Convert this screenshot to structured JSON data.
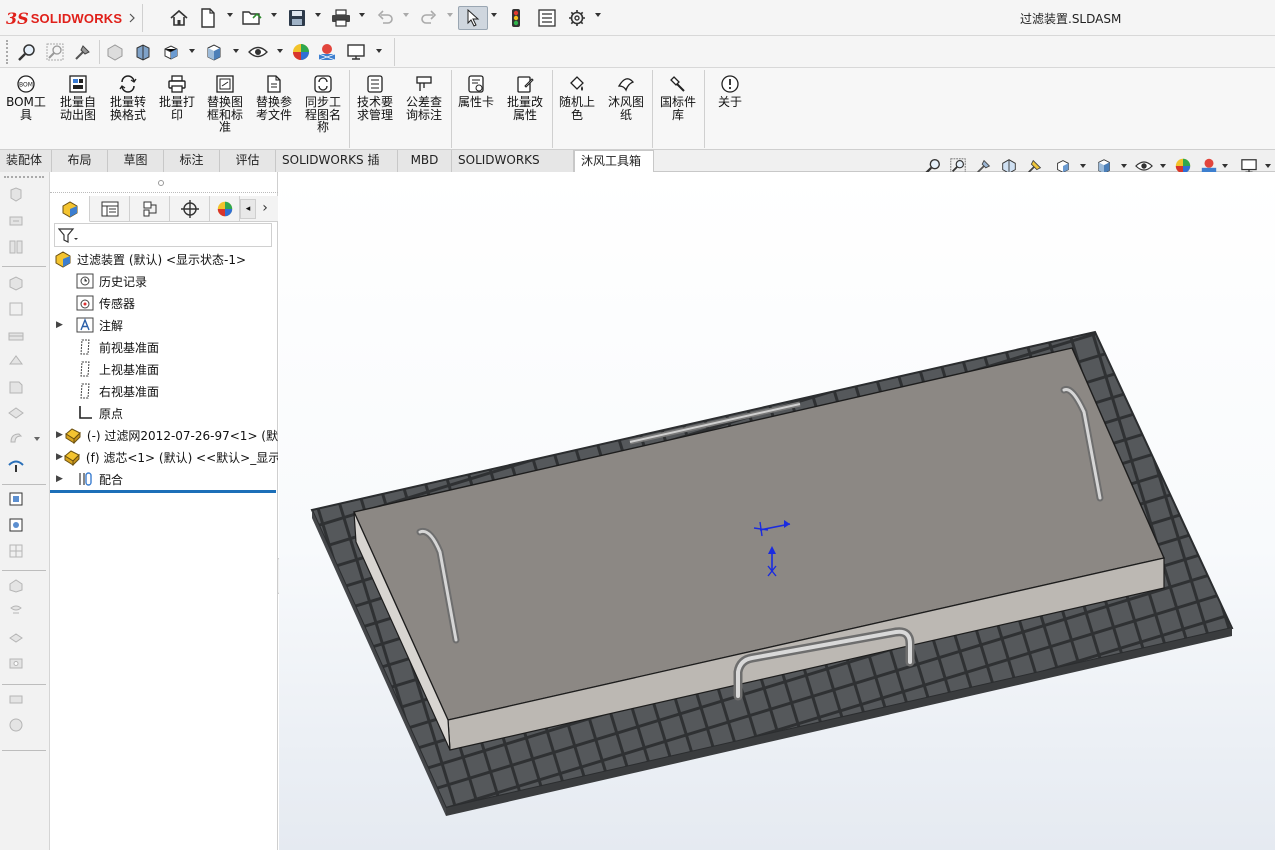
{
  "app": {
    "brand_ds": "3S",
    "brand_name": "SOLIDWORKS",
    "document_title": "过滤装置.SLDASM"
  },
  "ribbon": {
    "buttons": [
      {
        "label": "BOM工\n具",
        "icon": "bom-icon"
      },
      {
        "label": "批量自\n动出图",
        "icon": "batch-drawing-icon"
      },
      {
        "label": "批量转\n换格式",
        "icon": "batch-convert-icon"
      },
      {
        "label": "批量打\n印",
        "icon": "batch-print-icon"
      },
      {
        "label": "替换图\n框和标\n准",
        "icon": "replace-frame-icon"
      },
      {
        "label": "替换参\n考文件",
        "icon": "replace-reference-icon"
      },
      {
        "label": "同步工\n程图名\n称",
        "icon": "sync-name-icon"
      },
      {
        "label": "技术要\n求管理",
        "icon": "tech-req-icon"
      },
      {
        "label": "公差查\n询标注",
        "icon": "tolerance-icon"
      },
      {
        "label": "属性卡",
        "icon": "property-card-icon"
      },
      {
        "label": "批量改\n属性",
        "icon": "batch-property-icon"
      },
      {
        "label": "随机上\n色",
        "icon": "random-color-icon"
      },
      {
        "label": "沐风图\n纸",
        "icon": "mufeng-drawing-icon"
      },
      {
        "label": "国标件\n库",
        "icon": "gb-parts-icon"
      },
      {
        "label": "关于",
        "icon": "about-icon"
      }
    ]
  },
  "tabs": [
    {
      "label": "装配体"
    },
    {
      "label": "布局"
    },
    {
      "label": "草图"
    },
    {
      "label": "标注"
    },
    {
      "label": "评估"
    },
    {
      "label": "SOLIDWORKS 插件"
    },
    {
      "label": "MBD"
    },
    {
      "label": "SOLIDWORKS CAM"
    },
    {
      "label": "沐风工具箱"
    }
  ],
  "active_tab": "沐风工具箱",
  "feature_tree": {
    "root": "过滤装置 (默认) <显示状态-1>",
    "items": [
      {
        "label": "历史记录",
        "icon": "history-icon",
        "expandable": false
      },
      {
        "label": "传感器",
        "icon": "sensor-icon",
        "expandable": false
      },
      {
        "label": "注解",
        "icon": "annotation-icon",
        "expandable": true
      },
      {
        "label": "前视基准面",
        "icon": "plane-icon",
        "expandable": false
      },
      {
        "label": "上视基准面",
        "icon": "plane-icon",
        "expandable": false
      },
      {
        "label": "右视基准面",
        "icon": "plane-icon",
        "expandable": false
      },
      {
        "label": "原点",
        "icon": "origin-icon",
        "expandable": false
      },
      {
        "label": "(-) 过滤网2012-07-26-97<1> (默",
        "icon": "part-icon",
        "expandable": true
      },
      {
        "label": "(f) 滤芯<1> (默认) <<默认>_显示",
        "icon": "part-icon",
        "expandable": true
      },
      {
        "label": "配合",
        "icon": "mates-icon",
        "expandable": true
      }
    ]
  },
  "colors": {
    "brand_red": "#e0201a",
    "tab_active_bg": "#ffffff",
    "tree_underline": "#1c6fb8",
    "model_top": "#8c8884",
    "model_frame": "#4a4c4e",
    "triad_blue": "#1a2be0"
  }
}
